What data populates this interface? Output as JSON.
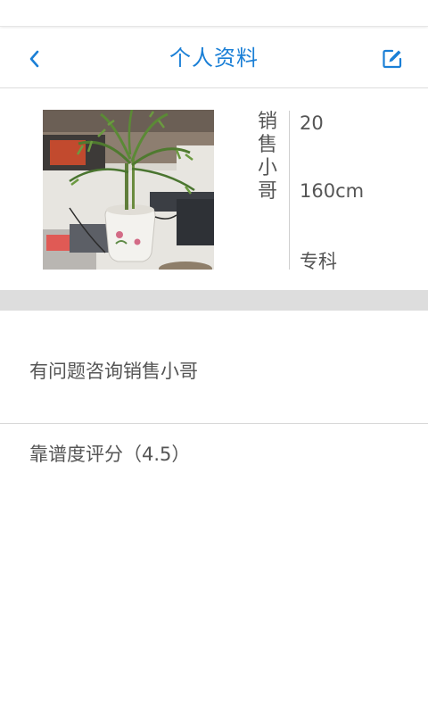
{
  "header": {
    "title": "个人资料",
    "back_icon": "chevron-left-icon",
    "edit_icon": "edit-icon",
    "accent_color": "#1a7fd6"
  },
  "profile": {
    "name_chars": [
      "销",
      "售",
      "小",
      "哥"
    ],
    "age": "20",
    "height": "160cm",
    "education": "专科"
  },
  "consult": {
    "label": "有问题咨询销售小哥"
  },
  "rating": {
    "prefix": "靠谱度评分（",
    "value": "4.5",
    "suffix": "）"
  }
}
